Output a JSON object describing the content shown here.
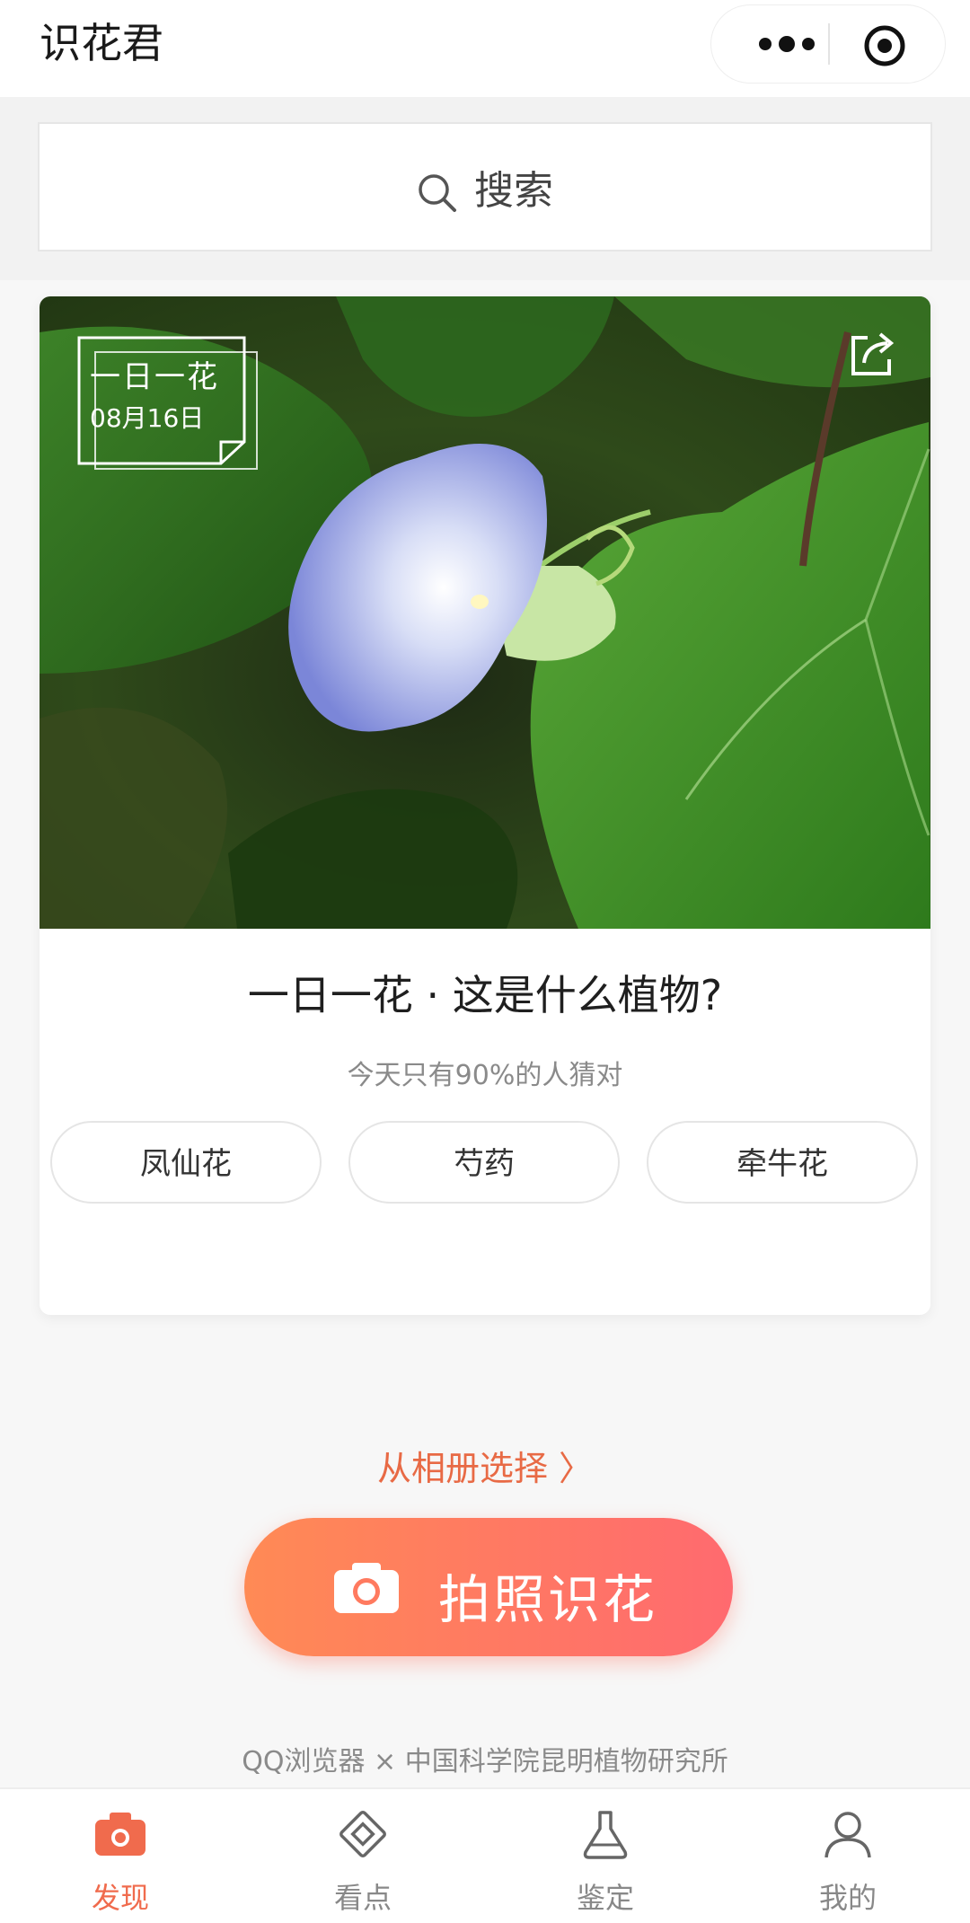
{
  "app": {
    "title": "识花君"
  },
  "search": {
    "placeholder": "搜索"
  },
  "daily": {
    "badge_title": "一日一花",
    "badge_date": "08月16日",
    "question": "一日一花 · 这是什么植物?",
    "hint": "今天只有90%的人猜对",
    "options": [
      "凤仙花",
      "芍药",
      "牵牛花"
    ]
  },
  "actions": {
    "album": "从相册选择 〉",
    "camera": "拍照识花"
  },
  "footer": {
    "text": "QQ浏览器 × 中国科学院昆明植物研究所"
  },
  "tabs": [
    {
      "label": "发现",
      "icon": "camera-icon",
      "active": true
    },
    {
      "label": "看点",
      "icon": "diamond-icon",
      "active": false
    },
    {
      "label": "鉴定",
      "icon": "flask-icon",
      "active": false
    },
    {
      "label": "我的",
      "icon": "user-icon",
      "active": false
    }
  ],
  "colors": {
    "accent": "#F06B4D",
    "button_start": "#FF8A55",
    "button_end": "#FF6A6F"
  }
}
